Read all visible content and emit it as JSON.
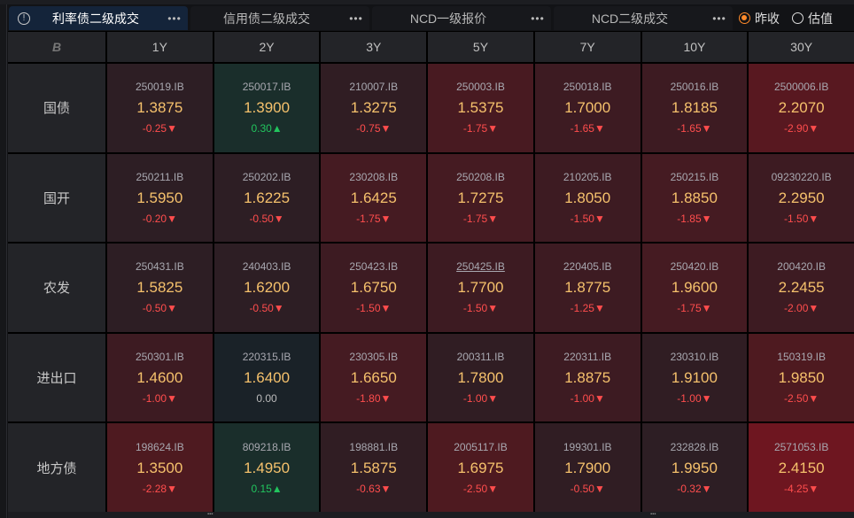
{
  "tabs": [
    {
      "label": "利率债二级成交",
      "active": true
    },
    {
      "label": "信用债二级成交",
      "active": false
    },
    {
      "label": "NCD一级报价",
      "active": false
    },
    {
      "label": "NCD二级成交",
      "active": false
    }
  ],
  "more_label": "•••",
  "info_icon": "!",
  "radios": [
    {
      "label": "昨收",
      "checked": true
    },
    {
      "label": "估值",
      "checked": false
    }
  ],
  "corner_icon": "B",
  "columns": [
    "1Y",
    "2Y",
    "3Y",
    "5Y",
    "7Y",
    "10Y",
    "30Y"
  ],
  "rows": [
    {
      "label": "国债",
      "cells": [
        {
          "code": "250019.IB",
          "value": "1.3875",
          "change": "-0.25",
          "dir": "down",
          "bg": "#2d1e24"
        },
        {
          "code": "250017.IB",
          "value": "1.3900",
          "change": "0.30",
          "dir": "up",
          "bg": "#1a2e2b"
        },
        {
          "code": "210007.IB",
          "value": "1.3275",
          "change": "-0.75",
          "dir": "down",
          "bg": "#301d23"
        },
        {
          "code": "250003.IB",
          "value": "1.5375",
          "change": "-1.75",
          "dir": "down",
          "bg": "#481a21"
        },
        {
          "code": "250018.IB",
          "value": "1.7000",
          "change": "-1.65",
          "dir": "down",
          "bg": "#3d1b22"
        },
        {
          "code": "250016.IB",
          "value": "1.8185",
          "change": "-1.65",
          "dir": "down",
          "bg": "#3d1b22"
        },
        {
          "code": "2500006.IB",
          "value": "2.2070",
          "change": "-2.90",
          "dir": "down",
          "bg": "#581820"
        }
      ]
    },
    {
      "label": "国开",
      "cells": [
        {
          "code": "250211.IB",
          "value": "1.5950",
          "change": "-0.20",
          "dir": "down",
          "bg": "#2d1e24"
        },
        {
          "code": "250202.IB",
          "value": "1.6225",
          "change": "-0.50",
          "dir": "down",
          "bg": "#2d1e24"
        },
        {
          "code": "230208.IB",
          "value": "1.6425",
          "change": "-1.75",
          "dir": "down",
          "bg": "#451b22"
        },
        {
          "code": "250208.IB",
          "value": "1.7275",
          "change": "-1.75",
          "dir": "down",
          "bg": "#451b22"
        },
        {
          "code": "210205.IB",
          "value": "1.8050",
          "change": "-1.50",
          "dir": "down",
          "bg": "#3d1b22"
        },
        {
          "code": "250215.IB",
          "value": "1.8850",
          "change": "-1.85",
          "dir": "down",
          "bg": "#451b22"
        },
        {
          "code": "09230220.IB",
          "value": "2.2950",
          "change": "-1.50",
          "dir": "down",
          "bg": "#3d1b22"
        }
      ]
    },
    {
      "label": "农发",
      "cells": [
        {
          "code": "250431.IB",
          "value": "1.5825",
          "change": "-0.50",
          "dir": "down",
          "bg": "#2d1e24"
        },
        {
          "code": "240403.IB",
          "value": "1.6200",
          "change": "-0.50",
          "dir": "down",
          "bg": "#2d1e24"
        },
        {
          "code": "250423.IB",
          "value": "1.6750",
          "change": "-1.50",
          "dir": "down",
          "bg": "#3d1b22"
        },
        {
          "code": "250425.IB",
          "value": "1.7700",
          "change": "-1.50",
          "dir": "down",
          "bg": "#3d1b22",
          "underline": true
        },
        {
          "code": "220405.IB",
          "value": "1.8775",
          "change": "-1.25",
          "dir": "down",
          "bg": "#3d1b22"
        },
        {
          "code": "250420.IB",
          "value": "1.9600",
          "change": "-1.75",
          "dir": "down",
          "bg": "#451b22"
        },
        {
          "code": "200420.IB",
          "value": "2.2455",
          "change": "-2.00",
          "dir": "down",
          "bg": "#3d1b22"
        }
      ]
    },
    {
      "label": "进出口",
      "cells": [
        {
          "code": "250301.IB",
          "value": "1.4600",
          "change": "-1.00",
          "dir": "down",
          "bg": "#3d1b22"
        },
        {
          "code": "220315.IB",
          "value": "1.6400",
          "change": "0.00",
          "dir": "flat",
          "bg": "#1a2228"
        },
        {
          "code": "230305.IB",
          "value": "1.6650",
          "change": "-1.80",
          "dir": "down",
          "bg": "#451b22"
        },
        {
          "code": "200311.IB",
          "value": "1.7800",
          "change": "-1.00",
          "dir": "down",
          "bg": "#301d23"
        },
        {
          "code": "220311.IB",
          "value": "1.8875",
          "change": "-1.00",
          "dir": "down",
          "bg": "#3d1b22"
        },
        {
          "code": "230310.IB",
          "value": "1.9100",
          "change": "-1.00",
          "dir": "down",
          "bg": "#301d23"
        },
        {
          "code": "150319.IB",
          "value": "1.9850",
          "change": "-2.50",
          "dir": "down",
          "bg": "#4e1a20"
        }
      ]
    },
    {
      "label": "地方债",
      "cells": [
        {
          "code": "198624.IB",
          "value": "1.3500",
          "change": "-2.28",
          "dir": "down",
          "bg": "#4e1a20"
        },
        {
          "code": "809218.IB",
          "value": "1.4950",
          "change": "0.15",
          "dir": "up",
          "bg": "#1a2e2b"
        },
        {
          "code": "198881.IB",
          "value": "1.5875",
          "change": "-0.63",
          "dir": "down",
          "bg": "#301d23"
        },
        {
          "code": "2005117.IB",
          "value": "1.6975",
          "change": "-2.50",
          "dir": "down",
          "bg": "#4e1a20"
        },
        {
          "code": "199301.IB",
          "value": "1.7900",
          "change": "-0.50",
          "dir": "down",
          "bg": "#301d23"
        },
        {
          "code": "232828.IB",
          "value": "1.9950",
          "change": "-0.32",
          "dir": "down",
          "bg": "#2d1e24"
        },
        {
          "code": "2571053.IB",
          "value": "2.4150",
          "change": "-4.25",
          "dir": "down",
          "bg": "#6e1620"
        }
      ]
    }
  ]
}
